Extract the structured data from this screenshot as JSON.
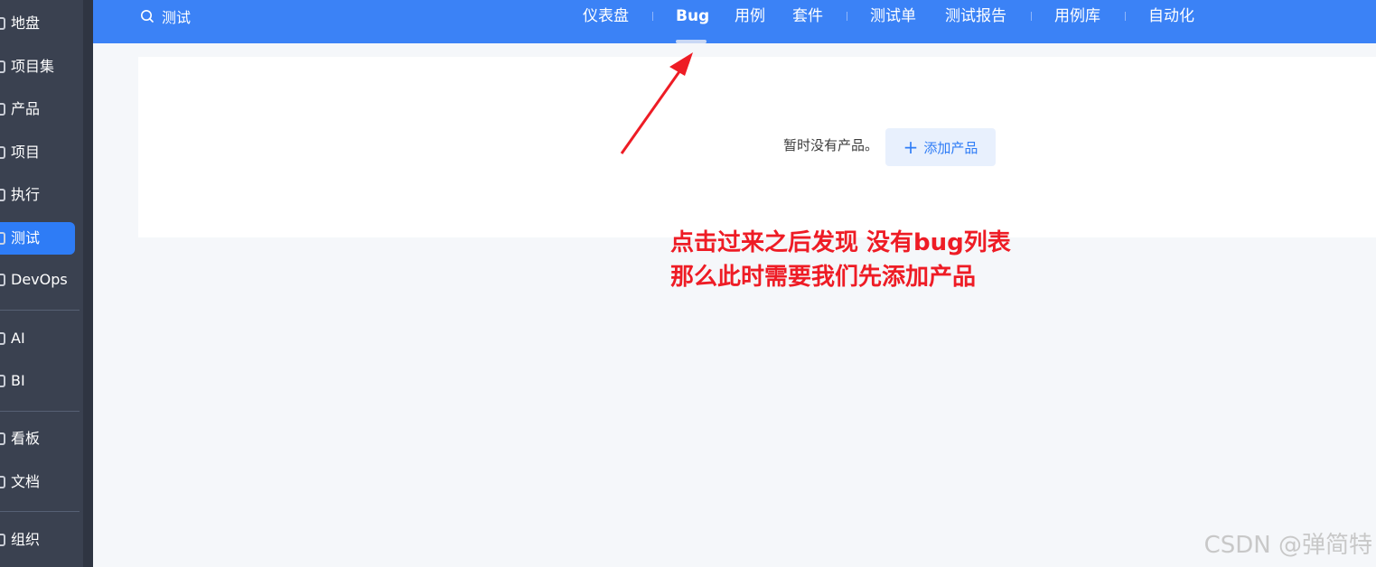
{
  "sidebar": {
    "items": [
      {
        "label": "地盘",
        "active": false
      },
      {
        "label": "项目集",
        "active": false
      },
      {
        "label": "产品",
        "active": false
      },
      {
        "label": "项目",
        "active": false
      },
      {
        "label": "执行",
        "active": false
      },
      {
        "label": "测试",
        "active": true
      },
      {
        "label": "DevOps",
        "active": false
      },
      {
        "label": "AI",
        "active": false
      },
      {
        "label": "BI",
        "active": false
      },
      {
        "label": "看板",
        "active": false
      },
      {
        "label": "文档",
        "active": false
      },
      {
        "label": "组织",
        "active": false
      }
    ]
  },
  "topbar": {
    "search_label": "测试",
    "nav": [
      {
        "label": "仪表盘"
      },
      {
        "label": "Bug",
        "active": true
      },
      {
        "label": "用例"
      },
      {
        "label": "套件"
      },
      {
        "label": "测试单"
      },
      {
        "label": "测试报告"
      },
      {
        "label": "用例库"
      },
      {
        "label": "自动化"
      }
    ]
  },
  "main": {
    "empty_text": "暂时没有产品。",
    "add_button_label": "添加产品"
  },
  "annotation": {
    "line1": "点击过来之后发现 没有bug列表",
    "line2": "那么此时需要我们先添加产品",
    "color": "#ee1c25"
  },
  "watermark": "CSDN @弹简特",
  "colors": {
    "topbar": "#3b82f6",
    "sidebar": "#3a4150",
    "accent": "#2e7cf6"
  }
}
